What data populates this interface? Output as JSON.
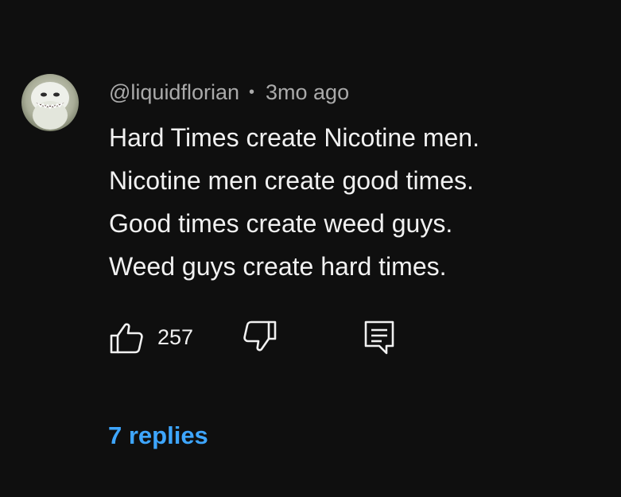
{
  "comment": {
    "author": "@liquidflorian",
    "separator": "•",
    "time": "3mo ago",
    "lines": [
      "Hard Times create Nicotine men.",
      "Nicotine men create good times.",
      "Good times create weed guys.",
      "Weed guys create hard times."
    ],
    "likes": "257",
    "replies_label": "7 replies"
  },
  "icons": {
    "avatar": "avatar-image",
    "like": "thumbs-up-icon",
    "dislike": "thumbs-down-icon",
    "reply": "comment-reply-icon"
  },
  "colors": {
    "background": "#0f0f0f",
    "text_primary": "#f1f1f1",
    "text_secondary": "#aaaaaa",
    "link": "#3ea6ff"
  }
}
